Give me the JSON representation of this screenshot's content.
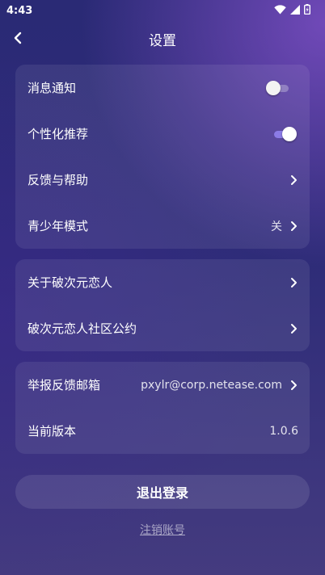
{
  "status_bar": {
    "time": "4:43"
  },
  "header": {
    "title": "设置"
  },
  "groups": [
    {
      "items": [
        {
          "label": "消息通知",
          "control": "toggle",
          "state": "off"
        },
        {
          "label": "个性化推荐",
          "control": "toggle",
          "state": "on"
        },
        {
          "label": "反馈与帮助",
          "control": "chevron"
        },
        {
          "label": "青少年模式",
          "control": "chevron",
          "value": "关"
        }
      ]
    },
    {
      "items": [
        {
          "label": "关于破次元恋人",
          "control": "chevron"
        },
        {
          "label": "破次元恋人社区公约",
          "control": "chevron"
        }
      ]
    },
    {
      "items": [
        {
          "label": "举报反馈邮箱",
          "control": "chevron",
          "value": "pxylr@corp.netease.com"
        },
        {
          "label": "当前版本",
          "value": "1.0.6"
        }
      ]
    }
  ],
  "actions": {
    "logout_label": "退出登录",
    "delete_account_label": "注销账号"
  },
  "colors": {
    "toggle_on": "#8b7be6",
    "card_bg": "rgba(255,255,255,0.08)"
  }
}
